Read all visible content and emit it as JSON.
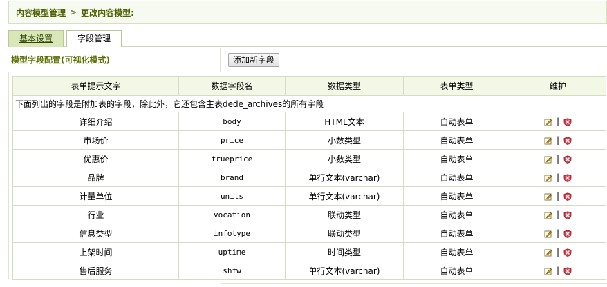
{
  "breadcrumb": {
    "root": "内容模型管理",
    "separator": ">",
    "current": "更改内容模型:"
  },
  "tabs": [
    {
      "label": "基本设置",
      "active": true
    },
    {
      "label": "字段管理",
      "active": false
    }
  ],
  "config": {
    "label": "模型字段配置(可视化模式)",
    "add_button": "添加新字段"
  },
  "table": {
    "headers": [
      "表单提示文字",
      "数据字段名",
      "数据类型",
      "表单类型",
      "维护"
    ],
    "note": "下面列出的字段是附加表的字段，除此外，它还包含主表dede_archives的所有字段",
    "action_separator": "|",
    "rows": [
      {
        "label": "详细介绍",
        "field": "body",
        "dtype": "HTML文本",
        "ftype": "自动表单"
      },
      {
        "label": "市场价",
        "field": "price",
        "dtype": "小数类型",
        "ftype": "自动表单"
      },
      {
        "label": "优惠价",
        "field": "trueprice",
        "dtype": "小数类型",
        "ftype": "自动表单"
      },
      {
        "label": "品牌",
        "field": "brand",
        "dtype": "单行文本(varchar)",
        "ftype": "自动表单"
      },
      {
        "label": "计量单位",
        "field": "units",
        "dtype": "单行文本(varchar)",
        "ftype": "自动表单"
      },
      {
        "label": "行业",
        "field": "vocation",
        "dtype": "联动类型",
        "ftype": "自动表单"
      },
      {
        "label": "信息类型",
        "field": "infotype",
        "dtype": "联动类型",
        "ftype": "自动表单"
      },
      {
        "label": "上架时间",
        "field": "uptime",
        "dtype": "时间类型",
        "ftype": "自动表单"
      },
      {
        "label": "售后服务",
        "field": "shfw",
        "dtype": "单行文本(varchar)",
        "ftype": "自动表单"
      }
    ]
  },
  "icons": {
    "edit": "edit-icon",
    "delete": "delete-icon"
  }
}
